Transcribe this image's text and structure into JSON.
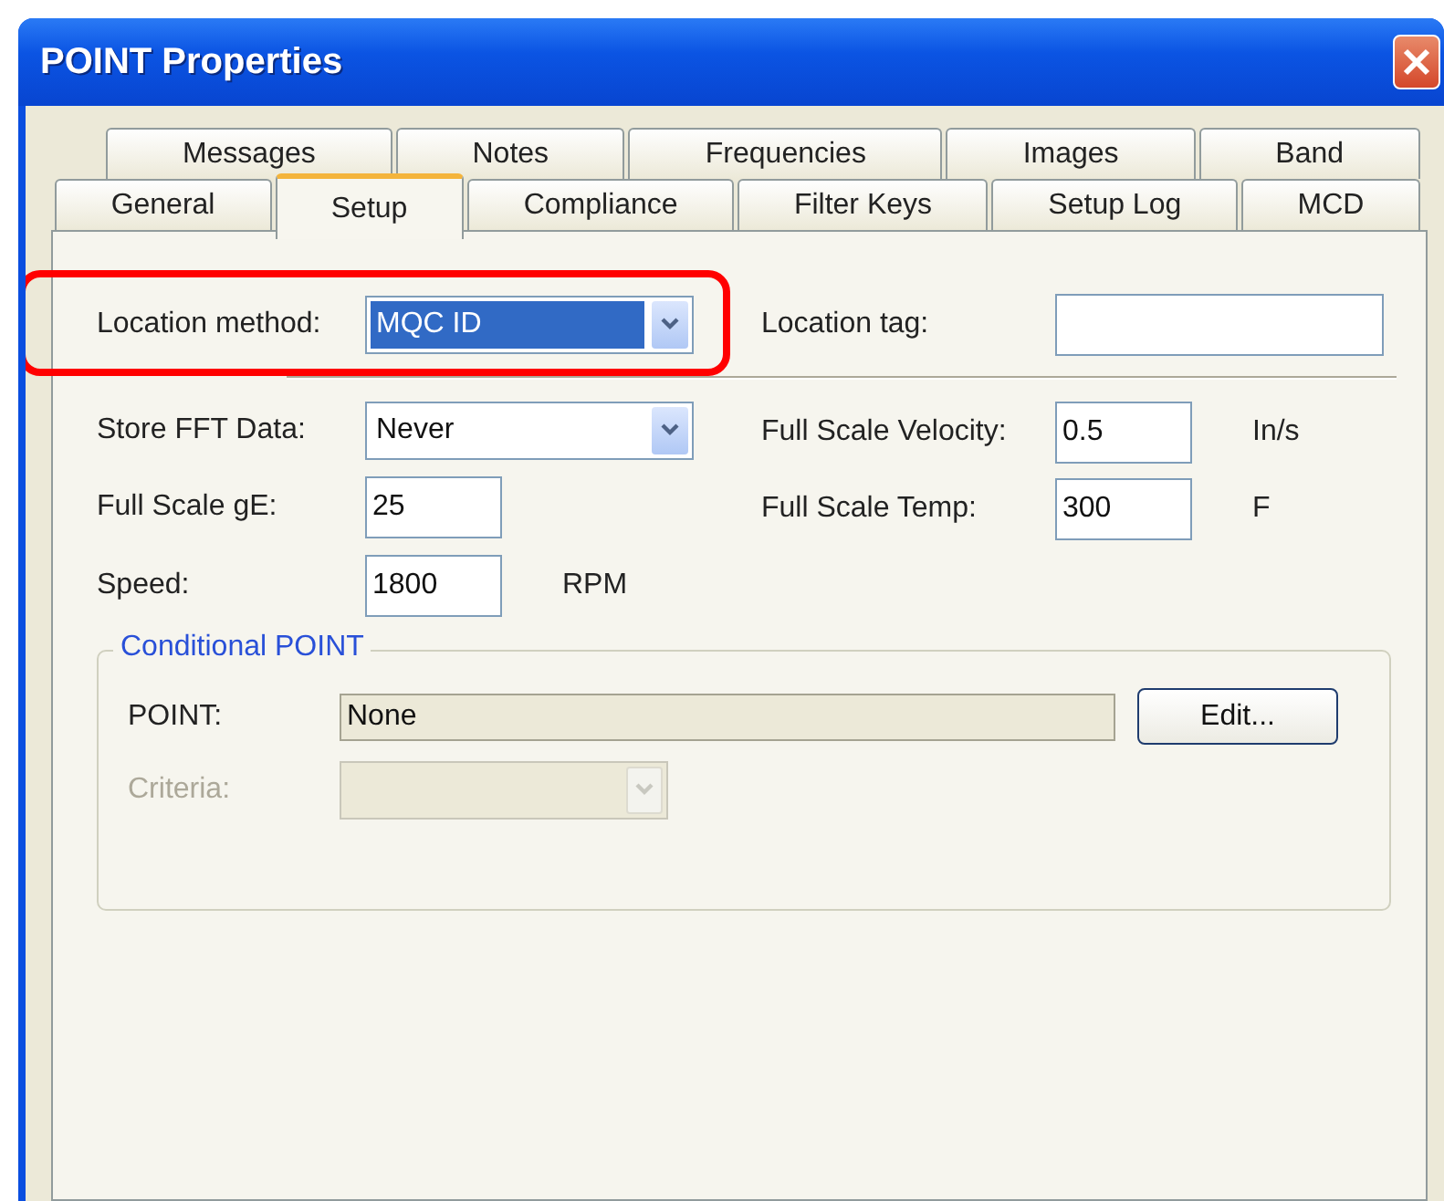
{
  "window": {
    "title": "POINT Properties"
  },
  "tab_rows": [
    [
      {
        "label": "Messages",
        "selected": false
      },
      {
        "label": "Notes",
        "selected": false
      },
      {
        "label": "Frequencies",
        "selected": false
      },
      {
        "label": "Images",
        "selected": false
      },
      {
        "label": "Band",
        "selected": false
      }
    ],
    [
      {
        "label": "General",
        "selected": false
      },
      {
        "label": "Setup",
        "selected": true
      },
      {
        "label": "Compliance",
        "selected": false
      },
      {
        "label": "Filter Keys",
        "selected": false
      },
      {
        "label": "Setup Log",
        "selected": false
      },
      {
        "label": "MCD",
        "selected": false
      }
    ]
  ],
  "location": {
    "method_label": "Location method:",
    "method_value": "MQC ID",
    "method_focused": true,
    "highlighted": true,
    "tag_label": "Location tag:"
  },
  "left_fields": [
    {
      "kind": "combo",
      "label": "Store FFT Data:",
      "value": "Never"
    },
    {
      "kind": "text",
      "label": "Full Scale gE:",
      "value": "25"
    },
    {
      "kind": "text",
      "label": "Speed:",
      "value": "1800",
      "unit": "RPM"
    }
  ],
  "right_fields": [
    {
      "kind": "text",
      "label": "Full Scale Velocity:",
      "value": "0.5",
      "unit": "In/s"
    },
    {
      "kind": "text",
      "label": "Full Scale Temp:",
      "value": "300",
      "unit": "F"
    }
  ],
  "conditional_point": {
    "title": "Conditional POINT",
    "point_label": "POINT:",
    "point_value": "None",
    "edit_button": "Edit...",
    "criteria_label": "Criteria:",
    "criteria_disabled": true
  }
}
